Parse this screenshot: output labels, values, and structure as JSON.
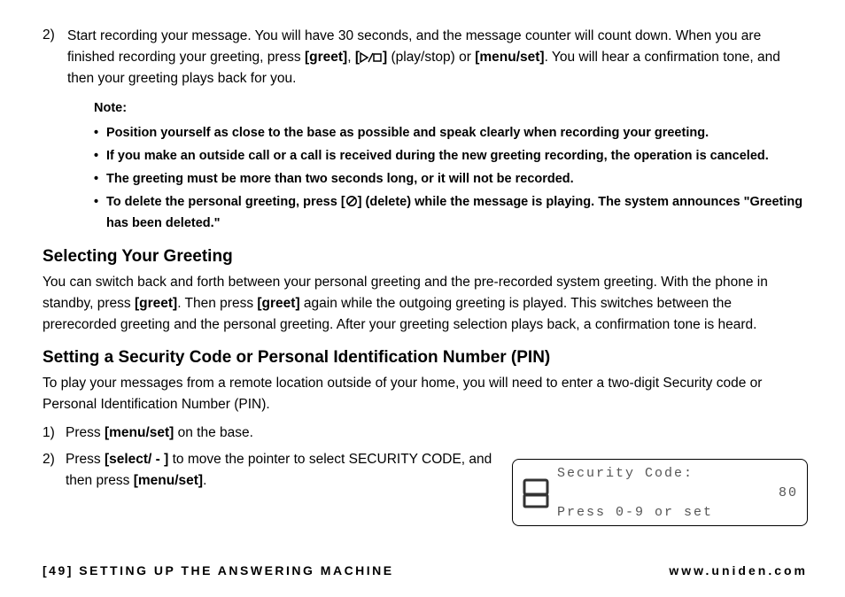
{
  "step2": {
    "num": "2)",
    "text_before": "Start recording your message. You will have 30 seconds, and the message counter will count down. When you are finished recording your greeting, press ",
    "greet": "[greet]",
    "comma": ", ",
    "bracket_open": "[",
    "bracket_close": "]",
    "playstop": " (play/stop) or ",
    "menuset": "[menu/set]",
    "text_after": ". You will hear a confirmation tone, and then your greeting plays back for you."
  },
  "note": {
    "title": "Note:",
    "items": [
      "Position yourself as close to the base as possible and speak clearly when recording your greeting.",
      "If you make an outside call or a call is received during the new greeting recording, the operation is canceled.",
      "The greeting must be more than two seconds long, or it will not be recorded."
    ],
    "delete_before": "To delete the personal greeting, press [",
    "delete_after": "] (delete) while the message is playing. The system announces \"Greeting has been deleted.\""
  },
  "sec1": {
    "heading": "Selecting Your Greeting",
    "p_a": "You can switch back and forth between your personal greeting and the pre-recorded system greeting. With the phone in standby, press ",
    "greet1": "[greet]",
    "p_b": ". Then press ",
    "greet2": "[greet]",
    "p_c": " again while the outgoing greeting is played. This switches between the prerecorded greeting and the personal greeting. After your greeting selection plays back, a confirmation tone is heard."
  },
  "sec2": {
    "heading": "Setting a Security Code or Personal Identification Number (PIN)",
    "intro": "To play your messages from a remote location outside of your home, you will need to enter a two-digit Security code or Personal Identification Number (PIN).",
    "s1_n": "1)",
    "s1_a": "Press ",
    "s1_b": "[menu/set]",
    "s1_c": " on the base.",
    "s2_n": "2)",
    "s2_a": "Press ",
    "s2_b": "[select/ - ]",
    "s2_c": " to move the pointer to select SECURITY CODE, and then press ",
    "s2_d": "[menu/set]",
    "s2_e": "."
  },
  "lcd": {
    "line1": "Security Code:",
    "line2": "80",
    "line3": "Press 0-9 or set"
  },
  "footer": {
    "left": "[49] SETTING UP THE ANSWERING MACHINE",
    "right": "www.uniden.com"
  }
}
